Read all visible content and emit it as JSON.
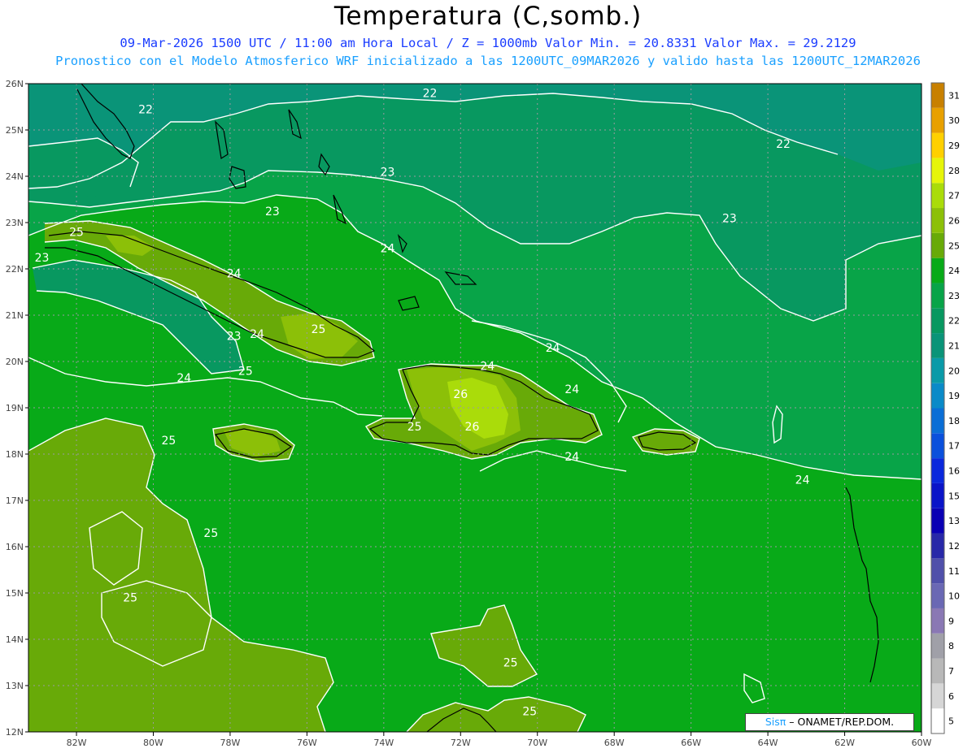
{
  "header": {
    "title": "Temperatura (C,somb.)",
    "line1": "09-Mar-2026 1500 UTC / 11:00 am Hora Local / Z = 1000mb  Valor Min. = 20.8331  Valor Max. = 29.2129",
    "line2": "Pronostico con el Modelo Atmosferico WRF inicializado a las 1200UTC_09MAR2026 y valido hasta las  1200UTC_12MAR2026"
  },
  "credit": {
    "sis": "Sisπ",
    "rest": "– ONAMET/REP.DOM."
  },
  "axes": {
    "lon_labels": [
      "82W",
      "80W",
      "78W",
      "76W",
      "74W",
      "72W",
      "70W",
      "68W",
      "66W",
      "64W",
      "62W",
      "60W"
    ],
    "lat_labels": [
      "26N",
      "25N",
      "24N",
      "23N",
      "22N",
      "21N",
      "20N",
      "19N",
      "18N",
      "17N",
      "16N",
      "15N",
      "14N",
      "13N",
      "12N"
    ],
    "lon_range": [
      -83.25,
      -60
    ],
    "lat_range": [
      12,
      26
    ]
  },
  "colorbar": {
    "labels": [
      "5",
      "6",
      "7",
      "8",
      "9",
      "10",
      "11",
      "12",
      "13",
      "15",
      "16",
      "17",
      "18",
      "19",
      "20",
      "21",
      "22",
      "23",
      "24",
      "25",
      "26",
      "27",
      "28",
      "29",
      "30",
      "31"
    ],
    "colors": [
      "#ffffff",
      "#d6d6d6",
      "#b8b8b8",
      "#a0a0a8",
      "#8a78b4",
      "#6a68b4",
      "#5050aa",
      "#2828a8",
      "#0a00b4",
      "#0a14c8",
      "#0a28dc",
      "#0a50dc",
      "#0a6ed6",
      "#0a8ac8",
      "#0a9aa8",
      "#0a9478",
      "#089860",
      "#08a448",
      "#08aa18",
      "#68aa08",
      "#8cc008",
      "#aadc0a",
      "#e6f50a",
      "#ffd000",
      "#e8a000",
      "#c88000"
    ]
  },
  "contour_labels": [
    {
      "text": "22",
      "lon": -80.2,
      "lat": 25.45
    },
    {
      "text": "22",
      "lon": -72.8,
      "lat": 25.8
    },
    {
      "text": "22",
      "lon": -63.6,
      "lat": 24.7
    },
    {
      "text": "23",
      "lon": -76.9,
      "lat": 23.25
    },
    {
      "text": "23",
      "lon": -73.9,
      "lat": 24.1
    },
    {
      "text": "23",
      "lon": -65.0,
      "lat": 23.1
    },
    {
      "text": "23",
      "lon": -82.9,
      "lat": 22.25
    },
    {
      "text": "23",
      "lon": -77.9,
      "lat": 20.55
    },
    {
      "text": "24",
      "lon": -73.9,
      "lat": 22.45
    },
    {
      "text": "24",
      "lon": -77.9,
      "lat": 21.9
    },
    {
      "text": "24",
      "lon": -77.3,
      "lat": 20.6
    },
    {
      "text": "24",
      "lon": -71.3,
      "lat": 19.9
    },
    {
      "text": "24",
      "lon": -69.6,
      "lat": 20.3
    },
    {
      "text": "24",
      "lon": -69.1,
      "lat": 19.4
    },
    {
      "text": "24",
      "lon": -79.2,
      "lat": 19.65
    },
    {
      "text": "24",
      "lon": -69.1,
      "lat": 17.95
    },
    {
      "text": "24",
      "lon": -63.1,
      "lat": 17.45
    },
    {
      "text": "25",
      "lon": -82.0,
      "lat": 22.8
    },
    {
      "text": "25",
      "lon": -75.7,
      "lat": 20.7
    },
    {
      "text": "25",
      "lon": -77.6,
      "lat": 19.8
    },
    {
      "text": "25",
      "lon": -73.2,
      "lat": 18.6
    },
    {
      "text": "25",
      "lon": -79.6,
      "lat": 18.3
    },
    {
      "text": "25",
      "lon": -78.5,
      "lat": 16.3
    },
    {
      "text": "25",
      "lon": -80.6,
      "lat": 14.9
    },
    {
      "text": "25",
      "lon": -70.7,
      "lat": 13.5
    },
    {
      "text": "25",
      "lon": -70.2,
      "lat": 12.45
    },
    {
      "text": "26",
      "lon": -72.0,
      "lat": 19.3
    },
    {
      "text": "26",
      "lon": -71.7,
      "lat": 18.6
    }
  ]
}
